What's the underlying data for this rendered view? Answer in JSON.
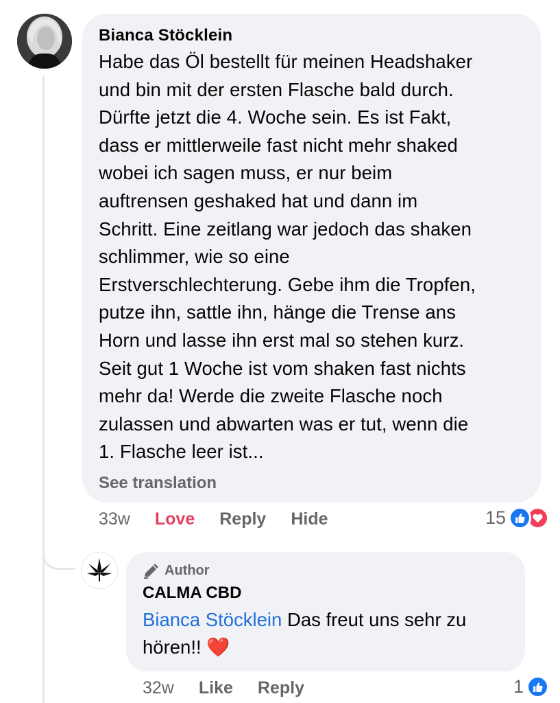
{
  "comment": {
    "author": "Bianca Stöcklein",
    "text_lines": [
      "Habe das Öl bestellt für meinen Headshaker",
      "und bin mit der ersten Flasche bald durch.",
      "Dürfte jetzt die 4. Woche sein. Es ist Fakt,",
      "dass er mittlerweile fast nicht mehr shaked",
      "wobei ich sagen muss, er nur beim",
      "auftrensen geshaked hat und dann im",
      "Schritt. Eine zeitlang war jedoch das shaken",
      "schlimmer, wie so eine",
      "Erstverschlechterung. Gebe ihm die Tropfen,",
      "putze ihn, sattle ihn, hänge die Trense ans",
      "Horn und lasse ihn erst mal so stehen kurz.",
      "Seit gut 1 Woche ist vom shaken fast nichts",
      "mehr da! Werde die zweite Flasche noch",
      "zulassen und abwarten was er tut, wenn die",
      "1. Flasche leer ist..."
    ],
    "see_translation": "See translation",
    "timestamp": "33w",
    "love_label": "Love",
    "reply_label": "Reply",
    "hide_label": "Hide",
    "reaction_count": "15",
    "reaction_icons": [
      "like-icon",
      "heart-icon"
    ]
  },
  "reply": {
    "badge": "Author",
    "badge_icon": "pencil-icon",
    "author": "CALMA CBD",
    "mention": "Bianca Stöcklein",
    "text_line1": " Das freut uns sehr zu",
    "text_line2": "hören!! ",
    "emoji": "❤️",
    "timestamp": "32w",
    "like_label": "Like",
    "reply_label": "Reply",
    "reaction_count": "1",
    "reaction_icons": [
      "like-icon"
    ]
  },
  "colors": {
    "bubble": "#f0f2f5",
    "secondary_text": "#65676b",
    "love": "#e4405f",
    "like_blue": "#1877f2",
    "mention_blue": "#216fdb"
  }
}
